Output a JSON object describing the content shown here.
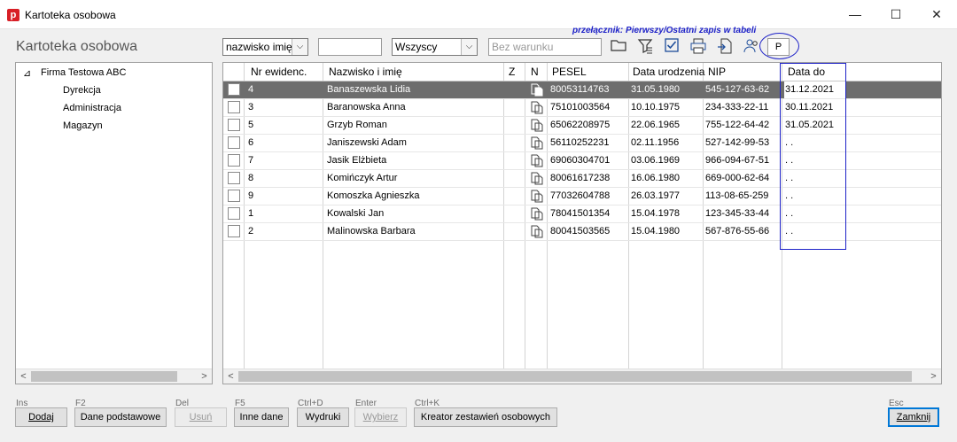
{
  "window": {
    "title": "Kartoteka osobowa",
    "app_icon_letter": "p",
    "min_glyph": "—",
    "max_glyph": "☐",
    "close_glyph": "✕"
  },
  "panel_title": "Kartoteka osobowa",
  "toolbar": {
    "sort_combo": "nazwisko imię",
    "search_value": "",
    "filter_combo": "Wszyscy",
    "condition_placeholder": "Bez warunku",
    "hint": "przełącznik: Pierwszy/Ostatni zapis w tabeli",
    "p_button": "P"
  },
  "tree": {
    "root": "Firma Testowa ABC",
    "root_toggle": "⊿",
    "children": [
      "Dyrekcja",
      "Administracja",
      "Magazyn"
    ]
  },
  "grid": {
    "headers": {
      "nr": "Nr ewidenc.",
      "name": "Nazwisko i imię",
      "z": "Z",
      "n": "N",
      "pesel": "PESEL",
      "dob": "Data urodzenia",
      "nip": "NIP",
      "data_do": "Data do"
    },
    "rows": [
      {
        "nr": "4",
        "name": "Banaszewska Lidia",
        "pesel": "80053114763",
        "dob": "31.05.1980",
        "nip": "545-127-63-62",
        "data_do": "31.12.2021"
      },
      {
        "nr": "3",
        "name": "Baranowska Anna",
        "pesel": "75101003564",
        "dob": "10.10.1975",
        "nip": "234-333-22-11",
        "data_do": "30.11.2021"
      },
      {
        "nr": "5",
        "name": "Grzyb Roman",
        "pesel": "65062208975",
        "dob": "22.06.1965",
        "nip": "755-122-64-42",
        "data_do": "31.05.2021"
      },
      {
        "nr": "6",
        "name": "Janiszewski Adam",
        "pesel": "56110252231",
        "dob": "02.11.1956",
        "nip": "527-142-99-53",
        "data_do": " .  ."
      },
      {
        "nr": "7",
        "name": "Jasik Elżbieta",
        "pesel": "69060304701",
        "dob": "03.06.1969",
        "nip": "966-094-67-51",
        "data_do": " .  ."
      },
      {
        "nr": "8",
        "name": "Komińczyk Artur",
        "pesel": "80061617238",
        "dob": "16.06.1980",
        "nip": "669-000-62-64",
        "data_do": " .  ."
      },
      {
        "nr": "9",
        "name": "Komoszka Agnieszka",
        "pesel": "77032604788",
        "dob": "26.03.1977",
        "nip": "113-08-65-259",
        "data_do": " .  ."
      },
      {
        "nr": "1",
        "name": "Kowalski Jan",
        "pesel": "78041501354",
        "dob": "15.04.1978",
        "nip": "123-345-33-44",
        "data_do": " .  ."
      },
      {
        "nr": "2",
        "name": "Malinowska Barbara",
        "pesel": "80041503565",
        "dob": "15.04.1980",
        "nip": "567-876-55-66",
        "data_do": " .  ."
      }
    ]
  },
  "buttons": {
    "add": {
      "key": "Ins",
      "label": "Dodaj"
    },
    "basic": {
      "key": "F2",
      "label": "Dane podstawowe"
    },
    "delete": {
      "key": "Del",
      "label": "Usuń"
    },
    "other": {
      "key": "F5",
      "label": "Inne dane"
    },
    "prints": {
      "key": "Ctrl+D",
      "label": "Wydruki"
    },
    "choose": {
      "key": "Enter",
      "label": "Wybierz"
    },
    "creator": {
      "key": "Ctrl+K",
      "label": "Kreator zestawień osobowych"
    },
    "close": {
      "key": "Esc",
      "label": "Zamknij"
    }
  },
  "colors": {
    "accent_annotation": "#1e22c8",
    "selected_row": "#6d6d6d",
    "app_red": "#d81f26"
  },
  "icons": {
    "scroll_left": "<",
    "scroll_right": ">",
    "combo_arrow": "⌵"
  }
}
